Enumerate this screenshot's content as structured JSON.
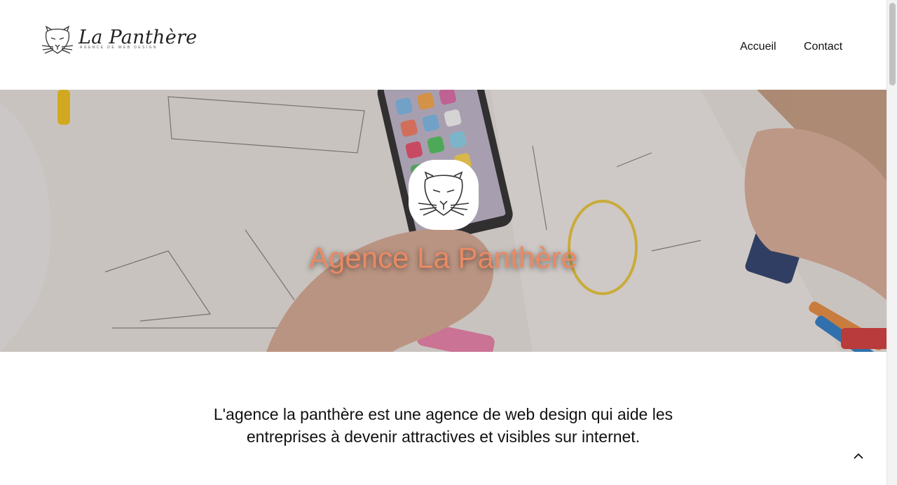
{
  "header": {
    "logo_title": "La Panthère",
    "logo_subtitle": "AGENCE DE WEB DESIGN",
    "nav": [
      {
        "label": "Accueil"
      },
      {
        "label": "Contact"
      }
    ]
  },
  "hero": {
    "title": "Agence La Panthère",
    "badge_icon": "panther-icon",
    "title_color": "#e98a63"
  },
  "intro": {
    "text": "L'agence la panthère est une agence de web design qui aide les entreprises à devenir attractives et visibles sur internet."
  },
  "scroll_top": {
    "icon": "chevron-up-icon"
  }
}
